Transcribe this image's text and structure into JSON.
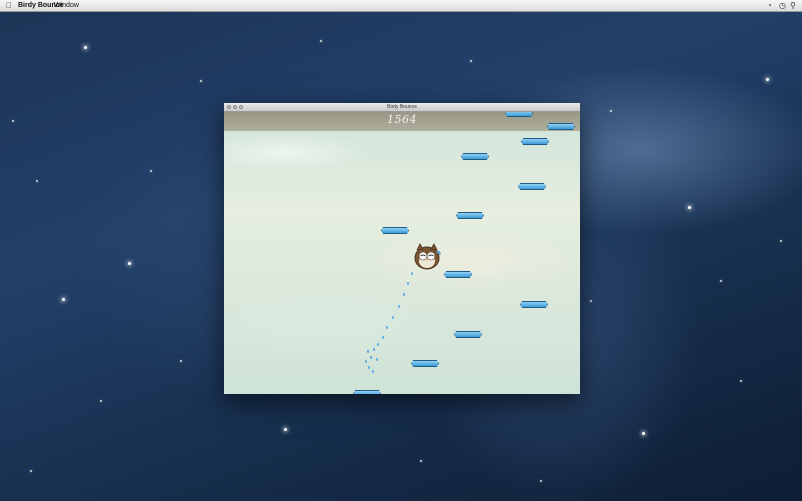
{
  "menubar": {
    "app_name": "Birdy Bounce",
    "menu_window": "Window"
  },
  "window": {
    "title": "Birdy Bounce"
  },
  "game": {
    "score": "1564"
  },
  "icons": {
    "apple": "apple-icon",
    "time_machine": "time-machine-icon",
    "spotlight": "spotlight-icon",
    "bird": "owl-bird-icon"
  },
  "colors": {
    "platform": "#3e9bd6",
    "score_band": "#9a9882",
    "sky": "#dde9dc"
  }
}
